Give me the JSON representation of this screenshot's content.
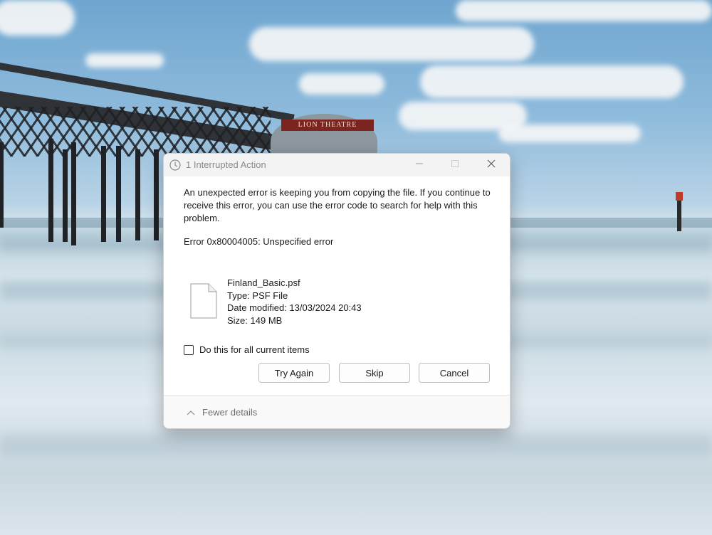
{
  "wallpaper": {
    "theatre_sign": "LION THEATRE"
  },
  "dialog": {
    "title": "1 Interrupted Action",
    "title_icon": "clock-icon",
    "controls": {
      "minimize_icon": "minimize-icon",
      "maximize_icon": "maximize-icon",
      "close_icon": "close-icon"
    },
    "message": "An unexpected error is keeping you from copying the file. If you continue to receive this error, you can use the error code to search for help with this problem.",
    "error_code": "Error 0x80004005: Unspecified error",
    "file": {
      "icon": "file-icon",
      "name": "Finland_Basic.psf",
      "type": "Type: PSF File",
      "date_modified": "Date modified: 13/03/2024 20:43",
      "size": "Size: 149 MB"
    },
    "checkbox_label": "Do this for all current items",
    "checkbox_checked": false,
    "buttons": {
      "try_again": "Try Again",
      "skip": "Skip",
      "cancel": "Cancel"
    },
    "footer": {
      "toggle_label": "Fewer details",
      "toggle_icon": "chevron-up-icon"
    }
  }
}
